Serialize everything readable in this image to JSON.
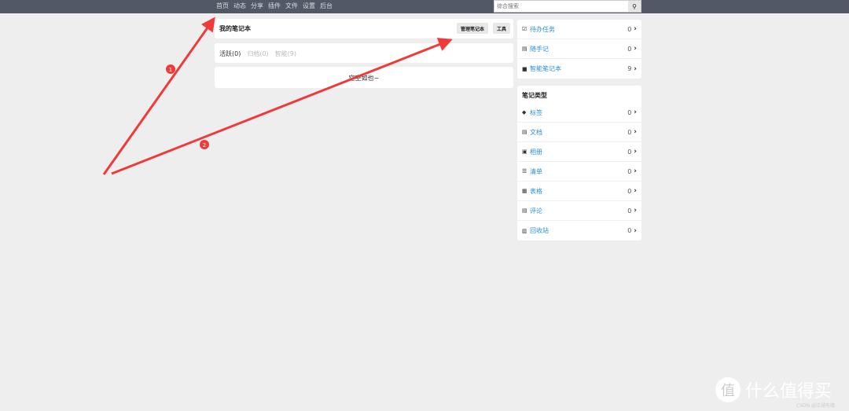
{
  "nav": [
    "首页",
    "动态",
    "分享",
    "插件",
    "文件",
    "设置",
    "后台"
  ],
  "search": {
    "placeholder": "综合搜索"
  },
  "header": {
    "title": "我的笔记本",
    "manage": "管理笔记本",
    "tools": "工具"
  },
  "tabs": [
    "活跃(0)",
    "归档(0)",
    "智能(9)"
  ],
  "empty": "空空如也~",
  "quick": [
    {
      "label": "待办任务",
      "count": "0",
      "icon": "calendar-check-icon",
      "g": "☑"
    },
    {
      "label": "随手记",
      "count": "0",
      "icon": "note-icon",
      "g": "▤"
    },
    {
      "label": "智能笔记本",
      "count": "9",
      "icon": "folder-icon",
      "g": "■"
    }
  ],
  "types": {
    "title": "笔记类型",
    "items": [
      {
        "label": "标签",
        "count": "0",
        "icon": "tags-icon",
        "g": "◆"
      },
      {
        "label": "文档",
        "count": "0",
        "icon": "file-icon",
        "g": "▤"
      },
      {
        "label": "相册",
        "count": "0",
        "icon": "image-icon",
        "g": "▣"
      },
      {
        "label": "清单",
        "count": "0",
        "icon": "list-icon",
        "g": "☰"
      },
      {
        "label": "表格",
        "count": "0",
        "icon": "table-icon",
        "g": "▦"
      },
      {
        "label": "评论",
        "count": "0",
        "icon": "comment-icon",
        "g": "▤"
      },
      {
        "label": "回收站",
        "count": "0",
        "icon": "trash-icon",
        "g": "▥"
      }
    ]
  },
  "annotations": [
    "1",
    "2"
  ],
  "watermark": {
    "logo": "值",
    "text": "什么值得买",
    "credit": "CSDN @江湖有缘"
  },
  "colors": {
    "topbar": "#525866",
    "link": "#2b8fd6",
    "arrow": "#f03a3a"
  }
}
